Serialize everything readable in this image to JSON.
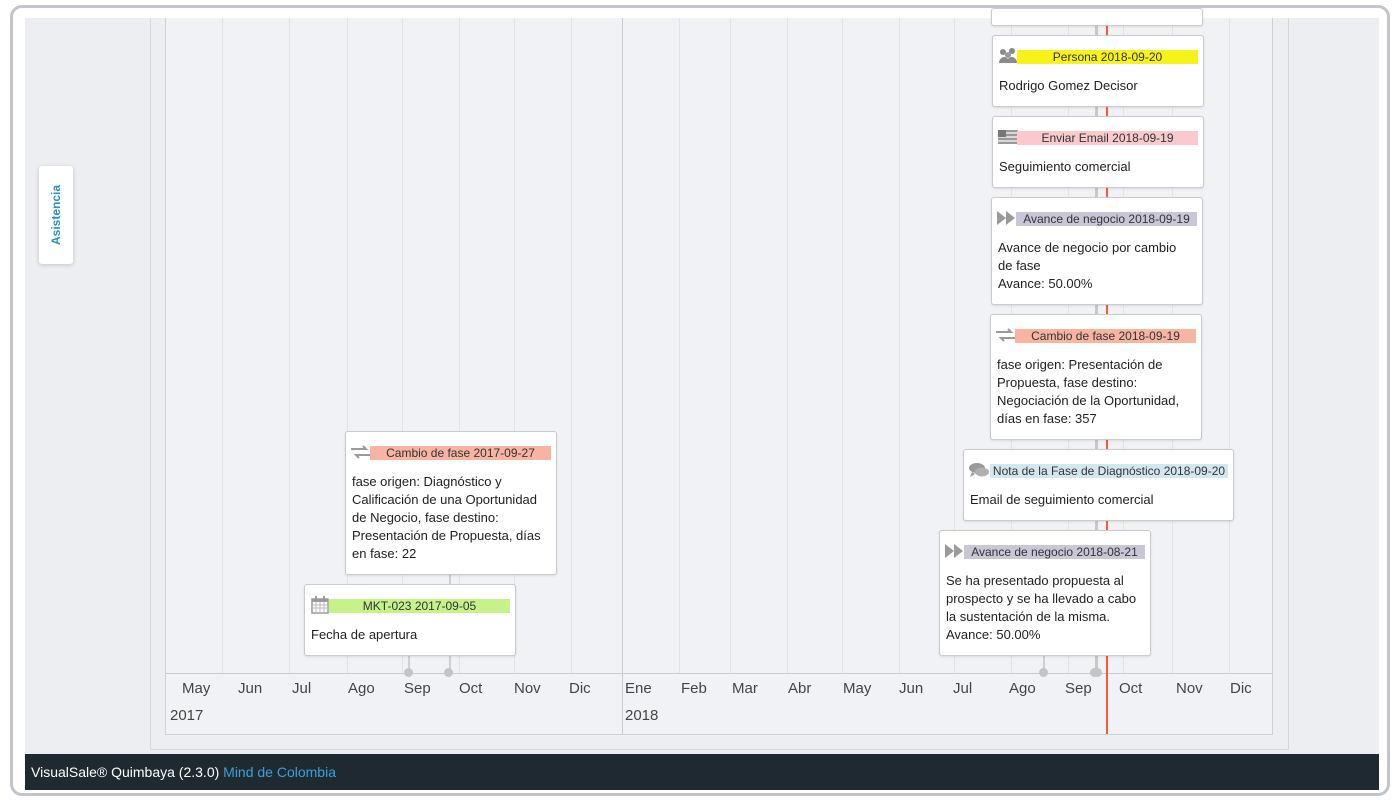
{
  "sidebar_tab": {
    "label": "Asistencia"
  },
  "timeline": {
    "months": [
      {
        "label": "May"
      },
      {
        "label": "Jun"
      },
      {
        "label": "Jul"
      },
      {
        "label": "Ago"
      },
      {
        "label": "Sep"
      },
      {
        "label": "Oct"
      },
      {
        "label": "Nov"
      },
      {
        "label": "Dic"
      },
      {
        "label": "Ene"
      },
      {
        "label": "Feb"
      },
      {
        "label": "Mar"
      },
      {
        "label": "Abr"
      },
      {
        "label": "May"
      },
      {
        "label": "Jun"
      },
      {
        "label": "Jul"
      },
      {
        "label": "Ago"
      },
      {
        "label": "Sep"
      },
      {
        "label": "Oct"
      },
      {
        "label": "Nov"
      },
      {
        "label": "Dic"
      }
    ],
    "years": [
      {
        "label": "2017"
      },
      {
        "label": "2018"
      }
    ],
    "events": [
      {
        "icon": "people-icon",
        "title": "Persona 2018-09-20",
        "highlight": "#f7f31a",
        "body": [
          "Rodrigo Gomez Decisor"
        ]
      },
      {
        "icon": "email-icon",
        "title": "Enviar Email 2018-09-19",
        "highlight": "#f9c9cd",
        "body": [
          "Seguimiento comercial"
        ]
      },
      {
        "icon": "fast-forward-icon",
        "title": "Avance de negocio 2018-09-19",
        "highlight": "#c9c6d8",
        "body": [
          "Avance de negocio por cambio",
          "de fase",
          "Avance: 50.00%"
        ]
      },
      {
        "icon": "swap-arrows-icon",
        "title": "Cambio de fase 2018-09-19",
        "highlight": "#f7b4a2",
        "body": [
          "fase origen: Presentación de",
          "Propuesta, fase destino:",
          "Negociación de la Oportunidad,",
          "días en fase: 357"
        ]
      },
      {
        "icon": "chat-icon",
        "title": "Nota de la Fase de Diagnóstico 2018-09-20",
        "highlight": "#d4e6f0",
        "body": [
          "Email de seguimiento comercial"
        ]
      },
      {
        "icon": "fast-forward-icon",
        "title": "Avance de negocio 2018-08-21",
        "highlight": "#c9c6d8",
        "body": [
          "Se ha presentado propuesta al",
          "prospecto y se ha llevado a cabo",
          "la sustentación de la misma.",
          "Avance: 50.00%"
        ]
      },
      {
        "icon": "swap-arrows-icon",
        "title": "Cambio de fase 2017-09-27",
        "highlight": "#f7b4a2",
        "body": [
          "fase origen: Diagnóstico y",
          "Calificación de una Oportunidad",
          "de Negocio, fase destino:",
          "Presentación de Propuesta, días",
          "en fase: 22"
        ]
      },
      {
        "icon": "calendar-icon",
        "title": "MKT-023 2017-09-05",
        "highlight": "#c6f28a",
        "body": [
          "Fecha de apertura"
        ]
      }
    ]
  },
  "footer": {
    "product": "VisualSale® Quimbaya (2.3.0)",
    "company": "Mind de Colombia"
  }
}
